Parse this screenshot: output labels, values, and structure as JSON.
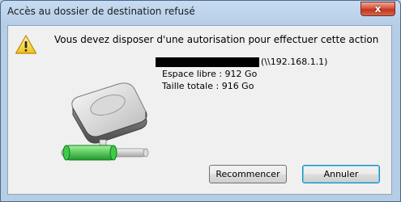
{
  "window": {
    "title": "Accès au dossier de destination refusé",
    "close_label": "x"
  },
  "dialog": {
    "message": "Vous devez disposer d'une autorisation pour effectuer cette action",
    "path_suffix": "(\\\\192.168.1.1)",
    "free_space": "Espace libre : 912 Go",
    "total_size": "Taille totale : 916 Go",
    "warning_icon": "warning-icon",
    "drive_icon": "network-drive-icon"
  },
  "buttons": {
    "retry": "Recommencer",
    "cancel": "Annuler"
  },
  "colors": {
    "title_bar": "#c7dcf1",
    "close_red": "#c3341e",
    "client_bg": "#f0f0f0",
    "default_button_border": "#3c7fb1"
  }
}
